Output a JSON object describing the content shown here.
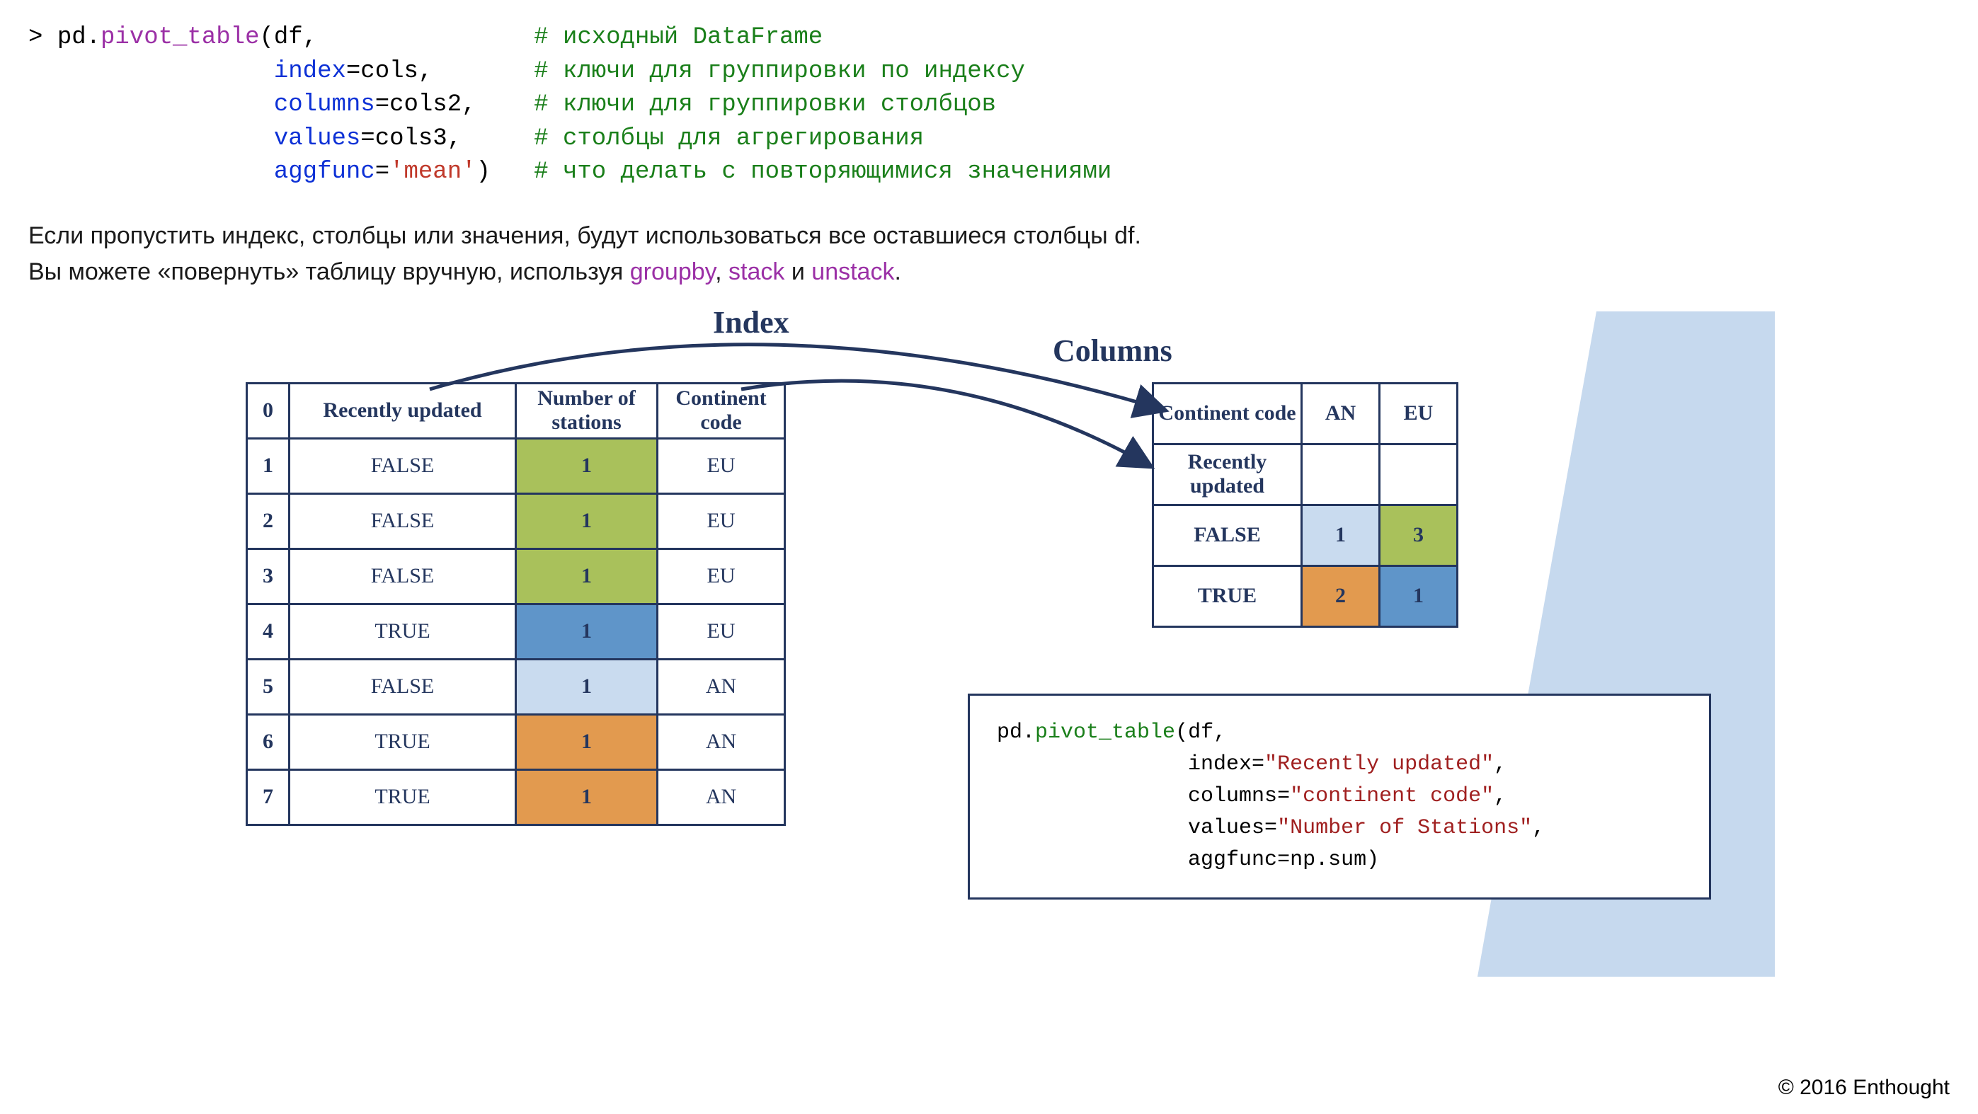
{
  "code": {
    "prompt": "> ",
    "mod": "pd",
    "fn": "pivot_table",
    "args": {
      "df": "df",
      "index": "index",
      "idx_val": "cols",
      "columns": "columns",
      "cols_val": "cols2",
      "values": "values",
      "vals_val": "cols3",
      "aggfunc": "aggfunc",
      "agg_val": "'mean'"
    },
    "comments": {
      "c1": "# исходный DataFrame",
      "c2": "# ключи для группировки по индексу",
      "c3": "# ключи для группировки столбцов",
      "c4": "# столбцы для агрегирования",
      "c5": "# что делать с повторяющимися значениями"
    }
  },
  "paragraph": {
    "p1": "Если пропустить индекс, столбцы или значения, будут использоваться все оставшиеся столбцы df.",
    "p2a": "Вы можете «повернуть» таблицу вручную, используя ",
    "groupby": "groupby",
    "sep1": ", ",
    "stack": "stack",
    "sep2": " и ",
    "unstack": "unstack",
    "end": "."
  },
  "diagram": {
    "label_index": "Index",
    "label_columns": "Columns",
    "src": {
      "h0": "0",
      "h1": "Recently updated",
      "h2": "Number of stations",
      "h3": "Continent code",
      "rows": [
        {
          "i": "1",
          "ru": "FALSE",
          "ns": "1",
          "cc": "EU",
          "cls": "c-olive"
        },
        {
          "i": "2",
          "ru": "FALSE",
          "ns": "1",
          "cc": "EU",
          "cls": "c-olive"
        },
        {
          "i": "3",
          "ru": "FALSE",
          "ns": "1",
          "cc": "EU",
          "cls": "c-olive"
        },
        {
          "i": "4",
          "ru": "TRUE",
          "ns": "1",
          "cc": "EU",
          "cls": "c-blue"
        },
        {
          "i": "5",
          "ru": "FALSE",
          "ns": "1",
          "cc": "AN",
          "cls": "c-lt"
        },
        {
          "i": "6",
          "ru": "TRUE",
          "ns": "1",
          "cc": "AN",
          "cls": "c-orange"
        },
        {
          "i": "7",
          "ru": "TRUE",
          "ns": "1",
          "cc": "AN",
          "cls": "c-orange"
        }
      ]
    },
    "res": {
      "h_cc": "Continent code",
      "h_an": "AN",
      "h_eu": "EU",
      "h_ru": "Recently updated",
      "r_false": "FALSE",
      "r_true": "TRUE",
      "v_f_an": "1",
      "v_f_eu": "3",
      "v_t_an": "2",
      "v_t_eu": "1"
    },
    "code2": {
      "l1a": "pd.",
      "l1b": "pivot_table",
      "l1c": "(df,",
      "l2a": "               index=",
      "l2b": "\"Recently updated\"",
      "l2c": ",",
      "l3a": "               columns=",
      "l3b": "\"continent code\"",
      "l3c": ",",
      "l4a": "               values=",
      "l4b": "\"Number of Stations\"",
      "l4c": ",",
      "l5": "               aggfunc=np.sum)"
    }
  },
  "copyright": "© 2016 Enthought"
}
